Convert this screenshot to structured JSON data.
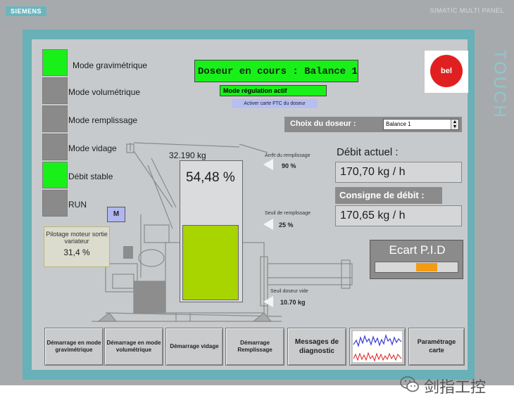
{
  "header": {
    "brand": "SIEMENS",
    "panel_name": "SIMATIC MULTI PANEL",
    "touch_label": "TOUCH"
  },
  "modes": [
    {
      "label": "Mode gravimétrique",
      "active": true
    },
    {
      "label": "Mode volumétrique",
      "active": false
    },
    {
      "label": "Mode remplissage",
      "active": false
    },
    {
      "label": "Mode vidage",
      "active": false
    },
    {
      "label": "Débit stable",
      "active": true
    },
    {
      "label": "RUN",
      "active": false
    }
  ],
  "status": {
    "doseur_en_cours": "Doseur en cours : Balance 1",
    "regulation": "Mode régulation actif",
    "activation": "Activer carte FTC du doseur"
  },
  "logo_text": "bel",
  "choix": {
    "label": "Choix du doseur :",
    "value": "Balance 1"
  },
  "debit": {
    "actuel_label": "Débit actuel :",
    "actuel_value": "170,70 kg / h",
    "consigne_label": "Consigne de débit :",
    "consigne_value": "170,65 kg / h"
  },
  "pid": {
    "label": "Ecart P.I.D"
  },
  "hopper": {
    "weight": "32.190 kg",
    "percent": "54,48 %",
    "fill_fraction": 0.5448
  },
  "motor": {
    "label": "M"
  },
  "pilotage": {
    "label": "Pilotage moteur sortie variateur",
    "value": "31,4 %"
  },
  "thresholds": {
    "arret_label": "Arrêt du remplissage",
    "arret_value": "90 %",
    "seuil_label": "Seuil de remplissage",
    "seuil_value": "25 %",
    "vide_label": "Seuil doseur vide",
    "vide_value": "10.70 kg"
  },
  "buttons": [
    "Démarrage en mode gravimétrique",
    "Démarrage en mode volumétrique",
    "Démarrage vidage",
    "Démarrage Remplissage",
    "Messages de diagnostic",
    "Paramétrage carte"
  ],
  "watermark": "剑指工控",
  "colors": {
    "active_green": "#19f019",
    "fill_green": "#a8d400",
    "pid_orange": "#f39c12",
    "bezel_teal": "#68b1b9"
  }
}
